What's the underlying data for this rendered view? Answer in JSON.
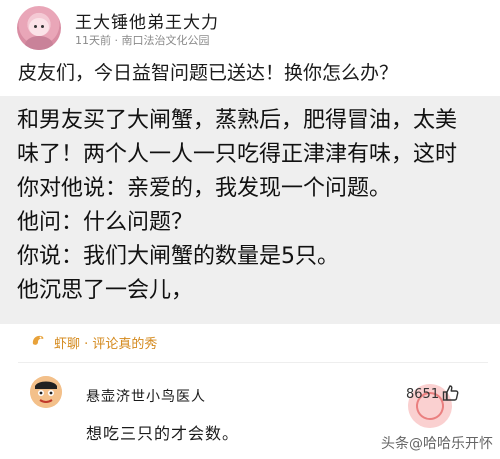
{
  "post": {
    "author": "王大锤他弟王大力",
    "meta": "11天前 · 南口法治文化公园",
    "text": "皮友们，今日益智问题已送达！换你怎么办？"
  },
  "quote": {
    "lines": [
      "和男友买了大闸蟹，蒸熟后，肥得冒油，太美",
      "味了！两个人一人一只吃得正津津有味，这时",
      "你对他说：亲爱的，我发现一个问题。",
      "他问：什么问题？",
      "你说：我们大闸蟹的数量是5只。",
      "他沉思了一会儿，"
    ]
  },
  "section": {
    "title": "虾聊 · 评论真的秀",
    "icon": "shrimp-icon"
  },
  "comment": {
    "user": "悬壶济世小鸟医人",
    "likes": "8651",
    "text": "想吃三只的才会数。"
  },
  "watermark": "头条@哈哈乐开怀",
  "colors": {
    "accent": "#d4891c",
    "quote_bg": "#efefef"
  }
}
